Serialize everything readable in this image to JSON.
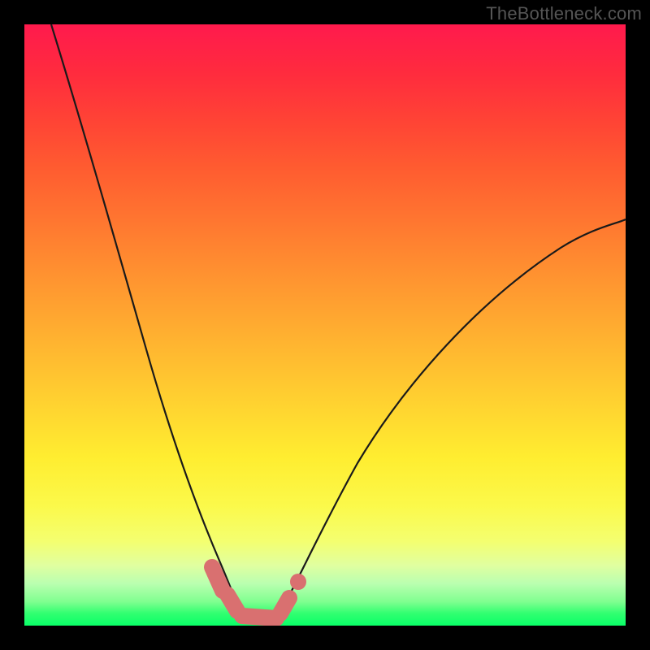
{
  "watermark": "TheBottleneck.com",
  "chart_data": {
    "type": "line",
    "title": "",
    "xlabel": "",
    "ylabel": "",
    "xlim": [
      0,
      1
    ],
    "ylim": [
      0,
      1
    ],
    "series": [
      {
        "name": "left-curve",
        "x": [
          0.045,
          0.08,
          0.12,
          0.16,
          0.2,
          0.24,
          0.28,
          0.32,
          0.355
        ],
        "y": [
          1.0,
          0.8,
          0.6,
          0.44,
          0.31,
          0.2,
          0.12,
          0.055,
          0.018
        ]
      },
      {
        "name": "right-curve",
        "x": [
          0.42,
          0.46,
          0.52,
          0.6,
          0.7,
          0.82,
          0.94,
          1.0
        ],
        "y": [
          0.018,
          0.07,
          0.17,
          0.3,
          0.43,
          0.55,
          0.64,
          0.675
        ]
      },
      {
        "name": "bottom-flat",
        "x": [
          0.355,
          0.42
        ],
        "y": [
          0.012,
          0.012
        ]
      }
    ],
    "markers": [
      {
        "name": "left-marker-top",
        "x": 0.318,
        "y": 0.075
      },
      {
        "name": "left-marker-mid",
        "x": 0.345,
        "y": 0.035
      },
      {
        "name": "bottom-marker",
        "x": 0.388,
        "y": 0.012
      },
      {
        "name": "right-marker-bot",
        "x": 0.432,
        "y": 0.03
      },
      {
        "name": "right-marker-top",
        "x": 0.455,
        "y": 0.075
      }
    ],
    "background_gradient": {
      "top": "#ff1a4d",
      "mid": "#ffd530",
      "bottom": "#0aff68"
    }
  }
}
